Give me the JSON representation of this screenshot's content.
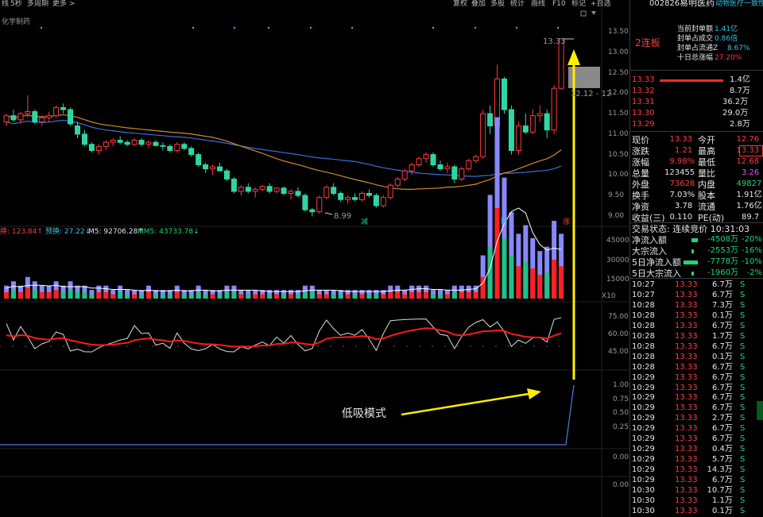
{
  "toolbar": {
    "left": [
      "线",
      "5秒",
      "多周期",
      "更多 >"
    ],
    "right": [
      "复权",
      "叠加",
      "多股",
      "统计",
      "画线",
      "F10",
      "标记",
      "+自选"
    ],
    "stock_code": "002826",
    "stock_name": "易明医药",
    "sector_tag": "动物医疗一致性"
  },
  "chart": {
    "indicator_name": "化学制药",
    "price_axis": [
      "13.50",
      "13.00",
      "12.50",
      "12.00",
      "11.50",
      "11.00",
      "10.50",
      "10.00",
      "9.50",
      "9.00"
    ],
    "high_label": "13.33",
    "low_label": "8.99",
    "range_label": "12.12 - 12",
    "markers": [
      "减",
      "财",
      "涨"
    ],
    "volume_indicator": {
      "label1": "换: 123.84↑",
      "label2": "预换: 27.22↓",
      "label3": "M5: 92706.28↑",
      "label4": "MM5: 43733.78↓"
    },
    "volume_axis": [
      "45000",
      "30000",
      "15000"
    ],
    "volume_unit": "X10",
    "osc_axis": [
      "75.00",
      "60.00",
      "45.00"
    ],
    "signal_axis": [
      "1.00",
      "0.75",
      "0.50",
      "0.25"
    ],
    "bottom_axis": [
      "0.00",
      "0.00"
    ],
    "annotation": "低吸模式"
  },
  "chart_data": {
    "type": "candlestick",
    "ylim": [
      8.9,
      13.6
    ],
    "candles": [
      [
        11.3,
        11.5,
        11.2,
        11.45
      ],
      [
        11.45,
        11.6,
        11.3,
        11.35
      ],
      [
        11.35,
        11.55,
        11.25,
        11.5
      ],
      [
        11.5,
        11.95,
        11.4,
        11.55
      ],
      [
        11.55,
        11.6,
        11.25,
        11.3
      ],
      [
        11.3,
        11.45,
        11.2,
        11.4
      ],
      [
        11.4,
        11.55,
        11.3,
        11.45
      ],
      [
        11.45,
        11.7,
        11.4,
        11.65
      ],
      [
        11.65,
        11.75,
        11.5,
        11.6
      ],
      [
        11.6,
        11.65,
        11.2,
        11.25
      ],
      [
        11.2,
        11.3,
        10.9,
        11.0
      ],
      [
        11.0,
        11.1,
        10.7,
        10.75
      ],
      [
        10.75,
        10.8,
        10.55,
        10.6
      ],
      [
        10.6,
        10.75,
        10.5,
        10.7
      ],
      [
        10.7,
        10.85,
        10.6,
        10.8
      ],
      [
        10.8,
        10.9,
        10.7,
        10.85
      ],
      [
        10.85,
        10.95,
        10.75,
        10.8
      ],
      [
        10.8,
        10.85,
        10.7,
        10.75
      ],
      [
        10.75,
        10.9,
        10.7,
        10.85
      ],
      [
        10.85,
        10.9,
        10.7,
        10.75
      ],
      [
        10.75,
        10.85,
        10.65,
        10.8
      ],
      [
        10.8,
        10.85,
        10.7,
        10.72
      ],
      [
        10.72,
        10.8,
        10.6,
        10.7
      ],
      [
        10.7,
        10.75,
        10.55,
        10.6
      ],
      [
        10.6,
        10.8,
        10.55,
        10.75
      ],
      [
        10.75,
        10.8,
        10.6,
        10.65
      ],
      [
        10.65,
        10.7,
        10.45,
        10.5
      ],
      [
        10.5,
        10.55,
        10.2,
        10.25
      ],
      [
        10.25,
        10.3,
        10.05,
        10.15
      ],
      [
        10.15,
        10.25,
        10.0,
        10.2
      ],
      [
        10.2,
        10.3,
        10.1,
        10.1
      ],
      [
        10.1,
        10.15,
        9.85,
        9.9
      ],
      [
        9.9,
        9.95,
        9.55,
        9.6
      ],
      [
        9.6,
        9.75,
        9.5,
        9.7
      ],
      [
        9.7,
        9.8,
        9.55,
        9.6
      ],
      [
        9.6,
        9.7,
        9.45,
        9.65
      ],
      [
        9.65,
        9.75,
        9.6,
        9.72
      ],
      [
        9.72,
        9.8,
        9.55,
        9.6
      ],
      [
        9.6,
        9.7,
        9.55,
        9.68
      ],
      [
        9.68,
        9.72,
        9.5,
        9.55
      ],
      [
        9.55,
        9.65,
        9.4,
        9.6
      ],
      [
        9.6,
        9.7,
        9.45,
        9.5
      ],
      [
        9.5,
        9.55,
        9.1,
        9.15
      ],
      [
        9.15,
        9.2,
        8.99,
        9.1
      ],
      [
        9.1,
        9.5,
        9.05,
        9.45
      ],
      [
        9.45,
        9.75,
        9.4,
        9.7
      ],
      [
        9.7,
        9.8,
        9.5,
        9.55
      ],
      [
        9.55,
        9.6,
        9.35,
        9.4
      ],
      [
        9.4,
        9.5,
        9.3,
        9.45
      ],
      [
        9.45,
        9.55,
        9.35,
        9.4
      ],
      [
        9.4,
        9.6,
        9.35,
        9.55
      ],
      [
        9.55,
        9.65,
        9.45,
        9.5
      ],
      [
        9.5,
        9.55,
        9.2,
        9.25
      ],
      [
        9.25,
        9.5,
        9.2,
        9.45
      ],
      [
        9.45,
        9.8,
        9.4,
        9.75
      ],
      [
        9.75,
        9.95,
        9.7,
        9.9
      ],
      [
        9.9,
        10.15,
        9.85,
        10.1
      ],
      [
        10.1,
        10.3,
        10.0,
        10.25
      ],
      [
        10.25,
        10.45,
        10.2,
        10.4
      ],
      [
        10.4,
        10.55,
        10.3,
        10.5
      ],
      [
        10.5,
        10.55,
        10.2,
        10.25
      ],
      [
        10.25,
        10.35,
        10.1,
        10.15
      ],
      [
        10.15,
        10.3,
        10.05,
        10.2
      ],
      [
        10.2,
        10.25,
        9.8,
        9.9
      ],
      [
        9.9,
        10.2,
        9.85,
        10.15
      ],
      [
        10.15,
        10.4,
        10.1,
        10.35
      ],
      [
        10.35,
        10.5,
        10.3,
        10.45
      ],
      [
        10.45,
        11.6,
        10.4,
        11.5
      ],
      [
        11.5,
        11.7,
        11.0,
        11.2
      ],
      [
        11.2,
        12.7,
        11.1,
        12.35
      ],
      [
        12.35,
        12.4,
        11.5,
        11.6
      ],
      [
        11.6,
        11.7,
        10.5,
        10.6
      ],
      [
        10.6,
        11.3,
        10.5,
        11.2
      ],
      [
        11.2,
        11.5,
        11.0,
        11.05
      ],
      [
        11.05,
        11.6,
        11.0,
        11.45
      ],
      [
        11.45,
        11.7,
        11.3,
        11.5
      ],
      [
        11.5,
        11.6,
        10.9,
        11.1
      ],
      [
        11.1,
        12.2,
        11.0,
        12.12
      ],
      [
        12.12,
        13.33,
        12.1,
        13.33
      ]
    ],
    "volume": [
      3,
      4,
      3,
      5,
      4,
      3,
      3,
      4,
      3,
      4,
      3,
      3,
      2,
      3,
      3,
      2,
      3,
      2,
      2,
      2,
      3,
      2,
      2,
      2,
      3,
      2,
      2,
      3,
      2,
      2,
      2,
      3,
      3,
      2,
      2,
      2,
      2,
      2,
      2,
      2,
      2,
      2,
      3,
      3,
      2,
      2,
      2,
      2,
      2,
      2,
      2,
      2,
      2,
      2,
      3,
      3,
      2,
      3,
      3,
      3,
      2,
      2,
      2,
      3,
      3,
      3,
      3,
      10,
      24,
      42,
      28,
      20,
      15,
      17,
      14,
      11,
      12,
      18,
      15
    ]
  },
  "quote": {
    "lianban": "2连板",
    "seal_info": [
      {
        "label": "当前封单额",
        "value": "1.41亿"
      },
      {
        "label": "封单占成交",
        "value": "0.86倍"
      },
      {
        "label": "封单占流通Z",
        "value": "8.67%"
      },
      {
        "label": "十日总涨幅",
        "value": "27.20%"
      }
    ],
    "order_book": [
      {
        "price": "13.33",
        "vol": "1.4亿"
      },
      {
        "price": "13.32",
        "vol": "8.7万"
      },
      {
        "price": "13.31",
        "vol": "36.2万"
      },
      {
        "price": "13.30",
        "vol": "29.0万"
      },
      {
        "price": "13.29",
        "vol": "2.8万"
      }
    ],
    "stats": [
      {
        "l1": "现价",
        "v1": "13.33",
        "l2": "今开",
        "v2": "12.76"
      },
      {
        "l1": "涨跌",
        "v1": "1.21",
        "l2": "最高",
        "v2": "13.33"
      },
      {
        "l1": "涨幅",
        "v1": "9.98%",
        "l2": "最低",
        "v2": "12.68"
      },
      {
        "l1": "总量",
        "v1": "123455",
        "l2": "量比",
        "v2": "3.26"
      },
      {
        "l1": "外盘",
        "v1": "73628",
        "l2": "内盘",
        "v2": "49827"
      },
      {
        "l1": "换手",
        "v1": "7.03%",
        "l2": "股本",
        "v2": "1.91亿"
      },
      {
        "l1": "净资",
        "v1": "3.78",
        "l2": "流通",
        "v2": "1.76亿"
      },
      {
        "l1": "收益(三)",
        "v1": "0.110",
        "l2": "PE(动)",
        "v2": "89.7"
      }
    ],
    "trade_status": "交易状态: 连续竞价 10:31:03",
    "flows": [
      {
        "label": "净流入额",
        "value": "-4508万",
        "pct": "-20%"
      },
      {
        "label": "大宗流入",
        "value": "-2553万",
        "pct": "-16%"
      },
      {
        "label": "5日净流入额",
        "value": "-7778万",
        "pct": "-10%"
      },
      {
        "label": "5日大宗流入",
        "value": "-1960万",
        "pct": "-2%"
      }
    ],
    "ticks": [
      {
        "t": "10:27",
        "p": "13.33",
        "v": "6.7万",
        "s": "S"
      },
      {
        "t": "10:27",
        "p": "13.33",
        "v": "6.7万",
        "s": "S"
      },
      {
        "t": "10:28",
        "p": "13.33",
        "v": "7.3万",
        "s": "S"
      },
      {
        "t": "10:28",
        "p": "13.33",
        "v": "0.1万",
        "s": "S"
      },
      {
        "t": "10:28",
        "p": "13.33",
        "v": "6.7万",
        "s": "S"
      },
      {
        "t": "10:28",
        "p": "13.33",
        "v": "1.7万",
        "s": "S"
      },
      {
        "t": "10:28",
        "p": "13.33",
        "v": "6.7万",
        "s": "S"
      },
      {
        "t": "10:28",
        "p": "13.33",
        "v": "0.1万",
        "s": "S"
      },
      {
        "t": "10:28",
        "p": "13.33",
        "v": "6.7万",
        "s": "S"
      },
      {
        "t": "10:29",
        "p": "13.33",
        "v": "6.7万",
        "s": "S"
      },
      {
        "t": "10:29",
        "p": "13.33",
        "v": "6.7万",
        "s": "S"
      },
      {
        "t": "10:29",
        "p": "13.33",
        "v": "6.7万",
        "s": "S"
      },
      {
        "t": "10:29",
        "p": "13.33",
        "v": "6.7万",
        "s": "S"
      },
      {
        "t": "10:29",
        "p": "13.33",
        "v": "2.7万",
        "s": "S"
      },
      {
        "t": "10:29",
        "p": "13.33",
        "v": "6.7万",
        "s": "S"
      },
      {
        "t": "10:29",
        "p": "13.33",
        "v": "6.7万",
        "s": "S"
      },
      {
        "t": "10:29",
        "p": "13.33",
        "v": "0.4万",
        "s": "S"
      },
      {
        "t": "10:29",
        "p": "13.33",
        "v": "5.7万",
        "s": "S"
      },
      {
        "t": "10:29",
        "p": "13.33",
        "v": "14.3万",
        "s": "S"
      },
      {
        "t": "10:29",
        "p": "13.33",
        "v": "6.7万",
        "s": "S"
      },
      {
        "t": "10:30",
        "p": "13.33",
        "v": "10.7万",
        "s": "S"
      },
      {
        "t": "10:30",
        "p": "13.33",
        "v": "1.1万",
        "s": "S"
      },
      {
        "t": "10:30",
        "p": "13.33",
        "v": "0.1万",
        "s": "S"
      }
    ]
  }
}
